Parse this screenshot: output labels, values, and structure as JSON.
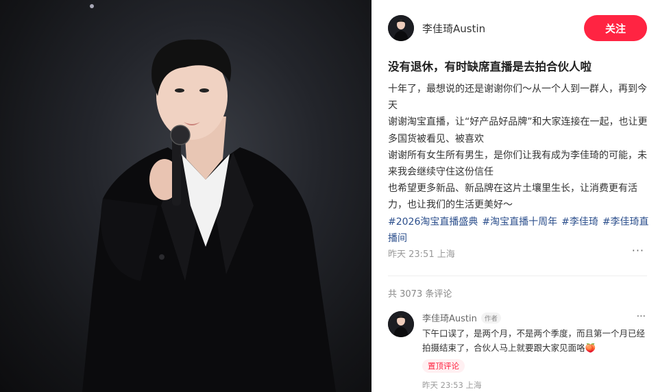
{
  "post": {
    "author": "李佳琦Austin",
    "follow_label": "关注",
    "title": "没有退休，有时缺席直播是去拍合伙人啦",
    "paragraphs": [
      "十年了，最想说的还是谢谢你们～从一个人到一群人，再到今天",
      "谢谢淘宝直播，让“好产品好品牌”和大家连接在一起，也让更多国货被看见、被喜欢",
      "谢谢所有女生所有男生，是你们让我有成为李佳琦的可能，未来我会继续守住这份信任",
      "也希望更多新品、新品牌在这片土壤里生长，让消费更有活力，也让我们的生活更美好～"
    ],
    "tags": [
      "#2026淘宝直播盛典",
      "#淘宝直播十周年",
      "#李佳琦",
      "#李佳琦直播间"
    ],
    "time": "昨天 23:51",
    "location": "上海",
    "more": "···"
  },
  "comments": {
    "count_text": "共 3073 条评论",
    "items": [
      {
        "name": "李佳琦Austin",
        "tag": "作者",
        "text": "下午口误了，是两个月，不是两个季度，而且第一个月已经拍摄结束了，合伙人马上就要跟大家见面咯🍑",
        "pinned": "置顶评论",
        "time": "昨天 23:53",
        "location": "上海",
        "more": "···"
      }
    ]
  },
  "colors": {
    "accent": "#ff2442",
    "tag": "#2c4f8c",
    "photo_bg": "#1a1b1f"
  },
  "icons": {
    "more": "more-dots-icon"
  }
}
